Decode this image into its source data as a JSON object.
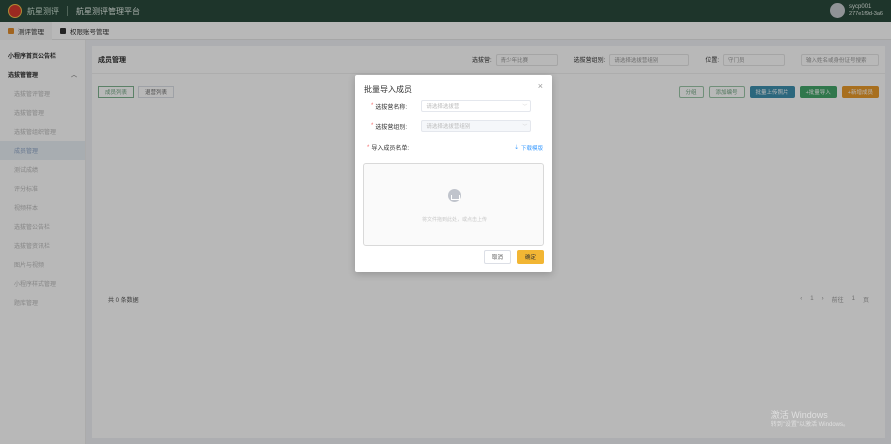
{
  "header": {
    "brand": "航星测评",
    "platform": "航星测评管理平台",
    "user_name": "sycp001",
    "user_sub": "277e1f9d-3a6"
  },
  "tabs": [
    {
      "label": "测评管理"
    },
    {
      "label": "权限账号管理"
    }
  ],
  "sidebar": {
    "items": [
      {
        "label": "小程序首页公告栏"
      },
      {
        "label": "选拔管管理"
      },
      {
        "label": "选拔管评管理"
      },
      {
        "label": "选拔管管理"
      },
      {
        "label": "选拔管组织管理"
      },
      {
        "label": "成员管理"
      },
      {
        "label": "测试成绩"
      },
      {
        "label": "评分标准"
      },
      {
        "label": "视频样本"
      },
      {
        "label": "选拔管公告栏"
      },
      {
        "label": "选拔管资讯栏"
      },
      {
        "label": "图片与视频"
      },
      {
        "label": "小程序样式管理"
      },
      {
        "label": "题库管理"
      }
    ]
  },
  "main": {
    "title": "成员管理",
    "filters": {
      "camp_label": "选拔营:",
      "camp_value": "青少年比赛",
      "group_label": "选拔营组别:",
      "group_placeholder": "请选择选拔营组别",
      "position_label": "位置:",
      "position_value": "守门员",
      "search_placeholder": "输入姓名或身份证号搜索"
    },
    "subtabs": [
      {
        "label": "成员列表"
      },
      {
        "label": "退营列表"
      }
    ],
    "actions": [
      {
        "label": "分组"
      },
      {
        "label": "添加编号"
      },
      {
        "label": "批量上传照片"
      },
      {
        "label": "+批量导入"
      },
      {
        "label": "+新增成员"
      }
    ],
    "total": "共 0 条数据",
    "pager": {
      "prev": "‹",
      "current": "1",
      "next": "›",
      "goto": "前往",
      "page_input": "1",
      "page_unit": "页"
    }
  },
  "dialog": {
    "title": "批量导入成员",
    "close": "×",
    "name_label": "选拔营名称:",
    "name_placeholder": "请选择选拔营",
    "group_label": "选拔营组别:",
    "group_placeholder": "请选择选拔营组别",
    "list_label": "导入成员名单:",
    "download": "下载模版",
    "upload_text": "将文件拖到此处，或点击上传",
    "cancel": "取消",
    "confirm": "确定"
  },
  "watermark": {
    "line1": "激活 Windows",
    "line2": "转到\"设置\"以激活 Windows。"
  }
}
